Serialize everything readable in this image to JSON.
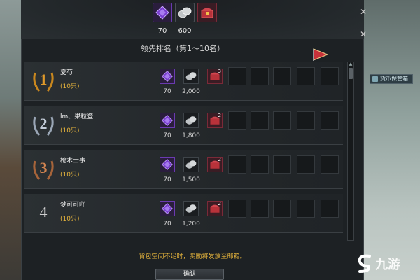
{
  "top_rewards": {
    "items": [
      {
        "icon": "purple-gem-icon",
        "value": "70"
      },
      {
        "icon": "silver-coins-icon",
        "value": "600"
      },
      {
        "icon": "red-chest-icon",
        "value": ""
      }
    ]
  },
  "panel": {
    "title": "领先排名（第1～10名）",
    "side_button": "货币保管箱"
  },
  "rows": [
    {
      "rank": "1",
      "rank_color": "#d68a1e",
      "name": "夏芍",
      "qty": "(10只)",
      "gem": "70",
      "coins": "2,000",
      "chest_count": "3"
    },
    {
      "rank": "2",
      "rank_color": "#aab4c4",
      "name": "lm、果粒登",
      "qty": "(10只)",
      "gem": "70",
      "coins": "1,800",
      "chest_count": "2"
    },
    {
      "rank": "3",
      "rank_color": "#b06a3e",
      "name": "枪术士事",
      "qty": "(10只)",
      "gem": "70",
      "coins": "1,500",
      "chest_count": "2"
    },
    {
      "rank": "4",
      "rank_color": "#cfcfcf",
      "name": "梦可可吖",
      "qty": "(10只)",
      "gem": "70",
      "coins": "1,200",
      "chest_count": "2"
    }
  ],
  "notice": "背包空间不足时，奖励将发放至邮箱。",
  "confirm_label": "确认",
  "watermark": "九游",
  "colors": {
    "accent_gold": "#e3b23c",
    "gem_purple": "#7a3fd0",
    "chest_red": "#b8323a"
  }
}
